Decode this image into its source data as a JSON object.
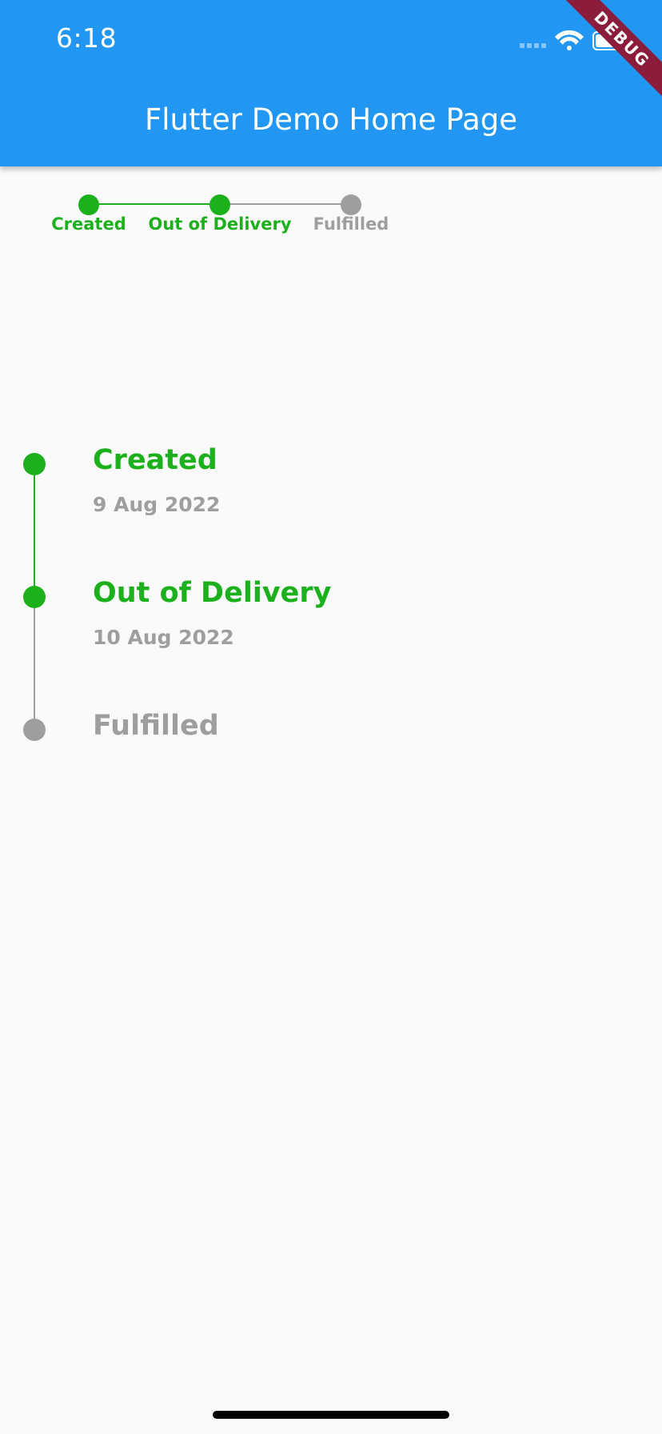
{
  "status_bar": {
    "time": "6:18"
  },
  "app_bar": {
    "title": "Flutter Demo Home Page",
    "debug_banner": "DEBUG"
  },
  "colors": {
    "appbar": "#2196F3",
    "active": "#1CB01C",
    "inactive": "#9E9E9E",
    "background": "#FAFAFA"
  },
  "horizontal_stepper": {
    "steps": [
      {
        "label": "Created",
        "active": true
      },
      {
        "label": "Out of Delivery",
        "active": true
      },
      {
        "label": "Fulfilled",
        "active": false
      }
    ]
  },
  "timeline": {
    "steps": [
      {
        "title": "Created",
        "date": "9 Aug 2022",
        "active": true
      },
      {
        "title": "Out of Delivery",
        "date": "10 Aug 2022",
        "active": true
      },
      {
        "title": "Fulfilled",
        "date": "",
        "active": false
      }
    ]
  }
}
